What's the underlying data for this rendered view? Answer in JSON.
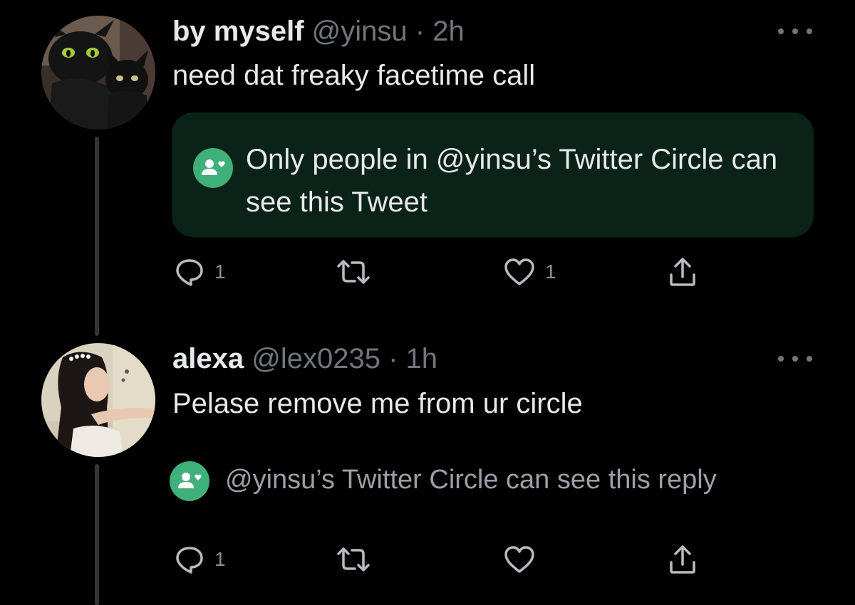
{
  "tweets": [
    {
      "display_name": "by myself",
      "handle": "@yinsu",
      "separator": "·",
      "time": "2h",
      "text": "need dat freaky facetime call",
      "avatar_icon": "dragon-and-cat-avatar",
      "circle_notice": "Only people in @yinsu’s Twitter Circle can see this Tweet",
      "actions": {
        "reply_count": "1",
        "retweet_count": "",
        "like_count": "1"
      }
    },
    {
      "display_name": "alexa",
      "handle": "@lex0235",
      "separator": "·",
      "time": "1h",
      "text": "Pelase remove me from ur circle",
      "avatar_icon": "girl-portrait-avatar",
      "circle_notice": "@yinsu’s Twitter Circle can see this reply",
      "actions": {
        "reply_count": "1",
        "retweet_count": "",
        "like_count": ""
      }
    }
  ],
  "colors": {
    "background": "#000000",
    "primary_text": "#e7e9ea",
    "secondary_text": "#71767b",
    "circle_green": "#3fb07a",
    "circle_box_bg": "#0b2219",
    "thread_line": "#333639"
  }
}
